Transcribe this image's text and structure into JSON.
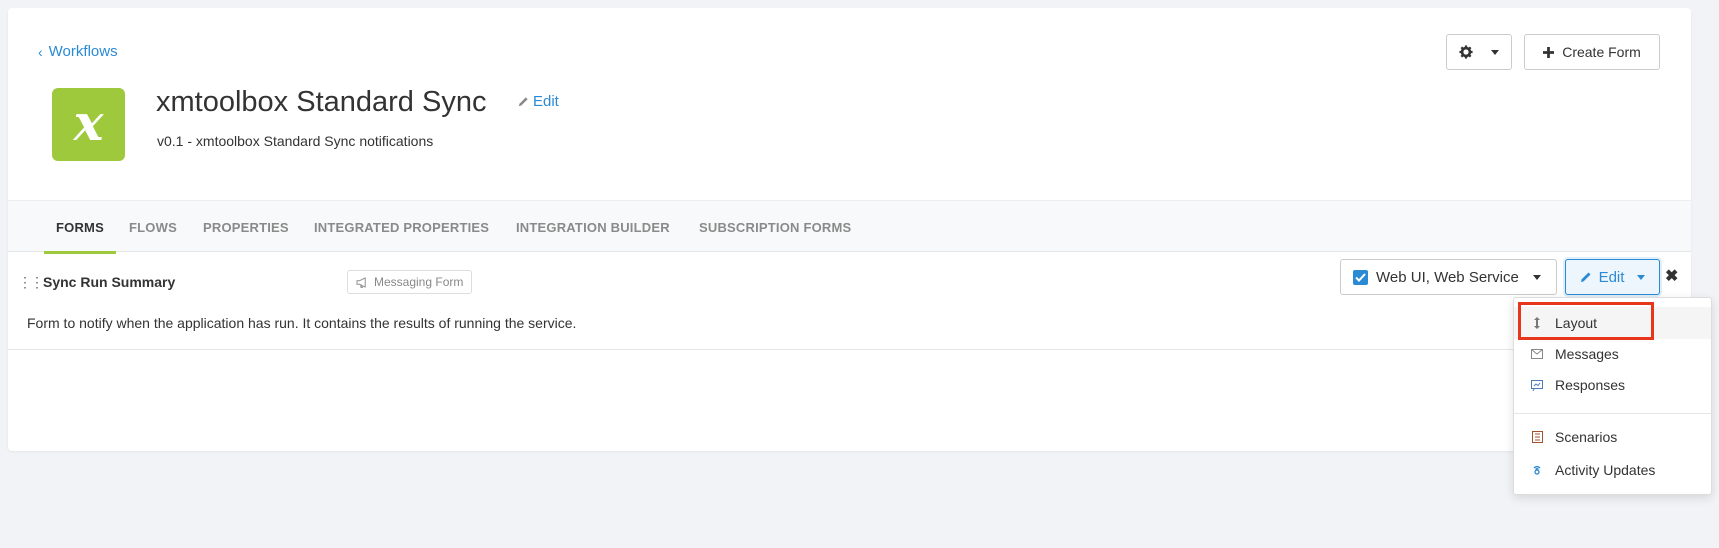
{
  "header": {
    "back_label": "Workflows",
    "logo_letter": "x",
    "title": "xmtoolbox Standard Sync",
    "title_edit_label": "Edit",
    "subtitle": "v0.1 - xmtoolbox Standard Sync notifications",
    "create_form_label": "Create Form"
  },
  "tabs": [
    {
      "label": "FORMS",
      "active": true
    },
    {
      "label": "FLOWS"
    },
    {
      "label": "PROPERTIES"
    },
    {
      "label": "INTEGRATED PROPERTIES"
    },
    {
      "label": "INTEGRATION BUILDER"
    },
    {
      "label": "SUBSCRIPTION FORMS"
    }
  ],
  "form": {
    "name": "Sync Run Summary",
    "type_badge": "Messaging Form",
    "description": "Form to notify when the application has run. It contains the results of running the service.",
    "channels_label": "Web UI, Web Service",
    "edit_label": "Edit"
  },
  "edit_menu": {
    "items": [
      {
        "label": "Layout",
        "icon": "layout-icon"
      },
      {
        "label": "Messages",
        "icon": "messages-icon"
      },
      {
        "label": "Responses",
        "icon": "responses-icon"
      },
      {
        "label": "Scenarios",
        "icon": "scenarios-icon"
      },
      {
        "label": "Activity Updates",
        "icon": "activity-updates-icon"
      }
    ]
  },
  "colors": {
    "accent_blue": "#2a8ad4",
    "brand_green": "#9fc93c",
    "highlight_red": "#e8361d"
  }
}
